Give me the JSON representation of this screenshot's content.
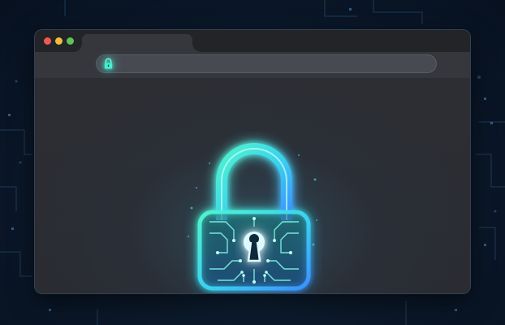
{
  "window": {
    "controls": [
      "close",
      "minimize",
      "maximize"
    ],
    "tab_label": "",
    "address_bar_text": ""
  },
  "icons": {
    "address_bar": "padlock-icon",
    "hero": "circuit-padlock-icon"
  },
  "colors": {
    "background": "#0c1a2c",
    "window": "#2d2f35",
    "titlebar": "#222428",
    "address_bar": "#484a51",
    "glow_cyan": "#3ff2d2",
    "glow_blue": "#3fb8ff",
    "close": "#ee5a52",
    "minimize": "#f2bd3c",
    "maximize": "#5ec455"
  }
}
